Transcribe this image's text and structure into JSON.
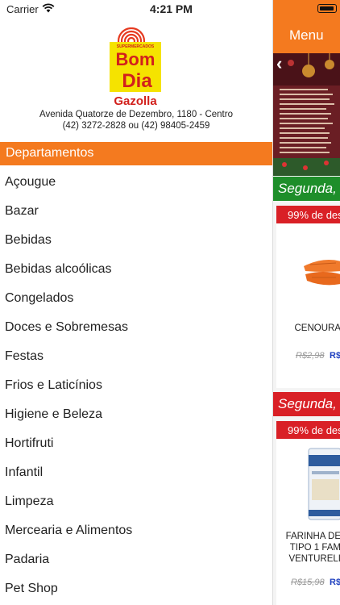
{
  "status": {
    "carrier": "Carrier",
    "time": "4:21 PM"
  },
  "store": {
    "logo_top": "SUPERMERCADOS",
    "logo_line1": "Bom",
    "logo_line2": "Dia",
    "name": "Gazolla",
    "address": "Avenida Quatorze de Dezembro, 1180 - Centro",
    "phones": "(42) 3272-2828 ou (42) 98405-2459"
  },
  "departments": {
    "title": "Departamentos",
    "items": [
      "Açougue",
      "Bazar",
      "Bebidas",
      "Bebidas alcoólicas",
      "Congelados",
      "Doces e Sobremesas",
      "Festas",
      "Frios e Laticínios",
      "Higiene e Beleza",
      "Hortifruti",
      "Infantil",
      "Limpeza",
      "Mercearia e Alimentos",
      "Padaria",
      "Pet Shop"
    ]
  },
  "panel": {
    "menu_title": "Menu",
    "day_label": "Segunda,",
    "product1": {
      "discount": "99% de des",
      "name": "CENOURA",
      "old_price": "R$2,98",
      "new_price": "R$"
    },
    "product2": {
      "discount": "99% de des",
      "name_line1": "FARINHA DE",
      "name_line2": "TIPO 1 FAM",
      "name_line3": "VENTURELI",
      "old_price": "R$15,98",
      "new_price": "R$"
    }
  },
  "colors": {
    "orange": "#f47a1f",
    "green": "#1e8e2a",
    "red": "#d92026",
    "price_blue": "#1d3fbf"
  }
}
